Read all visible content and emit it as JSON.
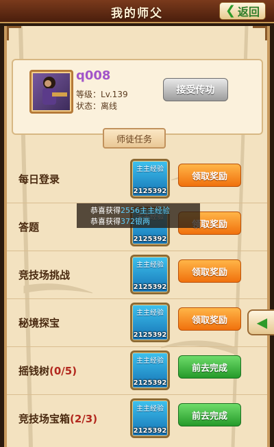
{
  "header": {
    "title": "我的师父",
    "back_label": "返回"
  },
  "profile": {
    "name": "q008",
    "level_label": "等级：",
    "level_value": "Lv.139",
    "status_label": "状态：",
    "status_value": "离线",
    "accept_button": "接受传功"
  },
  "tasks_title": "师徒任务",
  "tasks": [
    {
      "name": "每日登录",
      "count": "",
      "reward_type": "主主经验",
      "reward_qty": "2125392",
      "action": "领取奖励",
      "action_style": "orange"
    },
    {
      "name": "答题",
      "count": "",
      "reward_type": "主主经验",
      "reward_qty": "2125392",
      "action": "领取奖励",
      "action_style": "orange"
    },
    {
      "name": "竞技场挑战",
      "count": "",
      "reward_type": "主主经验",
      "reward_qty": "2125392",
      "action": "领取奖励",
      "action_style": "orange"
    },
    {
      "name": "秘境探宝",
      "count": "",
      "reward_type": "主主经验",
      "reward_qty": "2125392",
      "action": "领取奖励",
      "action_style": "orange"
    },
    {
      "name": "摇钱树",
      "count": "(0/5)",
      "reward_type": "主主经验",
      "reward_qty": "2125392",
      "action": "前去完成",
      "action_style": "green"
    },
    {
      "name": "竞技场宝箱",
      "count": "(2/3)",
      "reward_type": "主主经验",
      "reward_qty": "2125392",
      "action": "前去完成",
      "action_style": "green"
    }
  ],
  "toast": {
    "line1_prefix": "恭喜获得",
    "line1_value": "2556主主经验",
    "line2_prefix": "恭喜获得",
    "line2_value": "372银两"
  },
  "colors": {
    "name_purple": "#a255c9",
    "orange_button": "#f0710d",
    "green_button": "#259a2a",
    "back_green": "#2e9a2a"
  },
  "icons": {
    "back": "chevron-left-icon",
    "side_tab": "chevron-left-icon",
    "reward": "exp-reward-icon"
  }
}
